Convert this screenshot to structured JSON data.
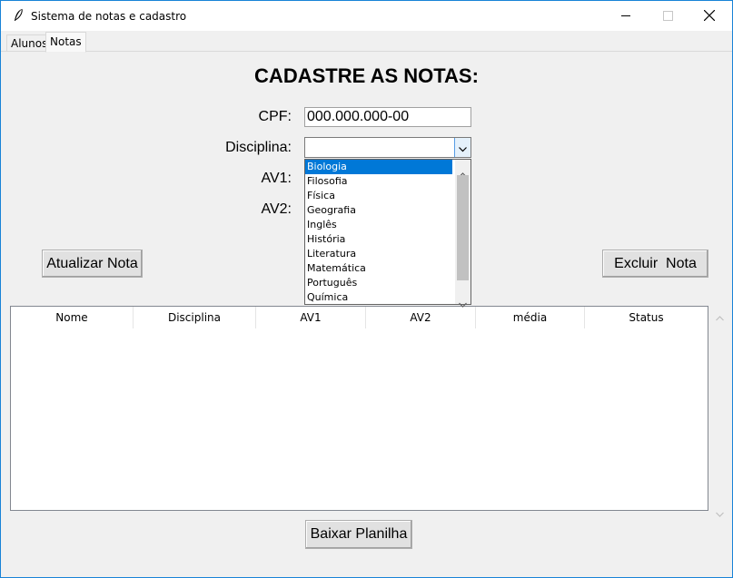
{
  "window": {
    "title": "Sistema de notas e cadastro",
    "accent": "#1883d7"
  },
  "tabs": [
    {
      "label": "Alunos",
      "active": false
    },
    {
      "label": "Notas",
      "active": true
    }
  ],
  "form": {
    "heading": "CADASTRE AS NOTAS:",
    "cpf_label": "CPF:",
    "cpf_value": "000.000.000-00",
    "disciplina_label": "Disciplina:",
    "disciplina_value": "",
    "av1_label": "AV1:",
    "av2_label": "AV2:"
  },
  "dropdown": {
    "options": [
      "Biologia",
      "Filosofia",
      "Física",
      "Geografia",
      "Inglês",
      "História",
      "Literatura",
      "Matemática",
      "Português",
      "Química"
    ],
    "highlighted": "Biologia",
    "highlight_color": "#0078d7"
  },
  "buttons": {
    "atualizar": "Atualizar Nota",
    "excluir": "Excluir  Nota",
    "baixar": "Baixar Planilha"
  },
  "table": {
    "columns": [
      "Nome",
      "Disciplina",
      "AV1",
      "AV2",
      "média",
      "Status"
    ],
    "rows": []
  },
  "icons": {
    "app": "feather-icon",
    "minimize": "minimize-icon",
    "maximize": "maximize-icon",
    "close": "close-icon"
  }
}
